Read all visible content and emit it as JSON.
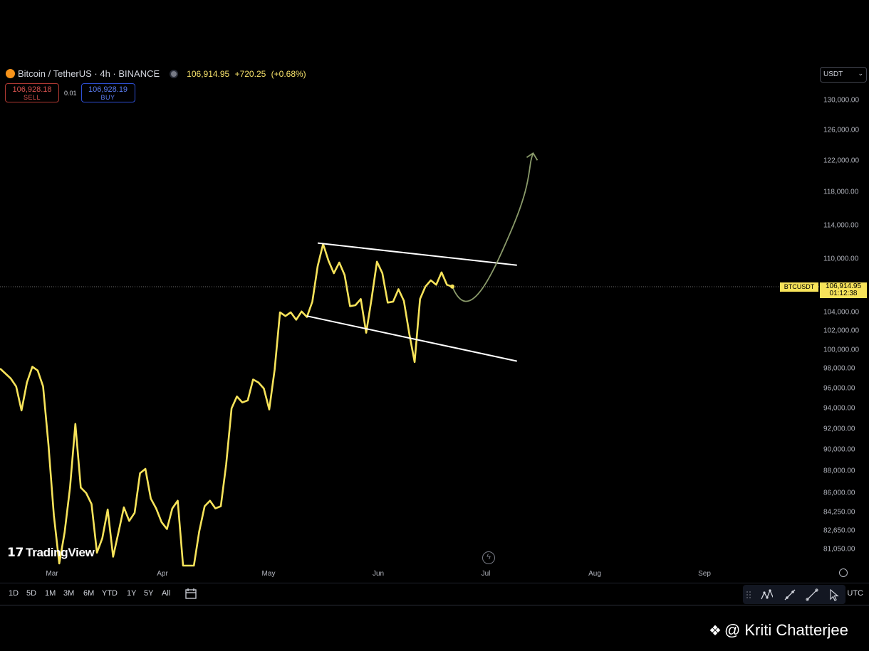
{
  "header": {
    "symbol_title": "Bitcoin / TetherUS · 4h · BINANCE",
    "last_price": "106,914.95",
    "change": "+720.25",
    "change_pct": "(+0.68%)",
    "sell_price": "106,928.18",
    "sell_label": "SELL",
    "spread": "0.01",
    "buy_price": "106,928.19",
    "buy_label": "BUY"
  },
  "currency_select": {
    "value": "USDT"
  },
  "price_axis": {
    "ticks": [
      "130,000.00",
      "126,000.00",
      "122,000.00",
      "118,000.00",
      "114,000.00",
      "110,000.00",
      "104,000.00",
      "102,000.00",
      "100,000.00",
      "98,000.00",
      "96,000.00",
      "94,000.00",
      "92,000.00",
      "90,000.00",
      "88,000.00",
      "86,000.00",
      "84,250.00",
      "82,650.00",
      "81,050.00"
    ],
    "current_symbol": "BTCUSDT",
    "current_price": "106,914.95",
    "countdown": "01:12:38"
  },
  "time_axis": {
    "labels": [
      "Mar",
      "Apr",
      "May",
      "Jun",
      "Jul",
      "Aug",
      "Sep"
    ]
  },
  "branding": {
    "logo_text": "TradingView",
    "watermark": "@ Kriti Chatterjee"
  },
  "bottom_bar": {
    "ranges": [
      "1D",
      "5D",
      "1M",
      "3M",
      "6M",
      "YTD",
      "1Y",
      "5Y",
      "All"
    ],
    "timezone": "UTC"
  },
  "colors": {
    "price_line": "#f7e35a",
    "channel": "#ffffff",
    "projection": "#8a9a6a",
    "background": "#000000"
  },
  "chart_data": {
    "type": "line",
    "series": [
      {
        "values": [
          [
            0,
            98000
          ],
          [
            1,
            97500
          ],
          [
            2,
            97000
          ],
          [
            3,
            96200
          ],
          [
            4,
            93800
          ],
          [
            5,
            96600
          ],
          [
            6,
            98200
          ],
          [
            7,
            97800
          ],
          [
            8,
            96200
          ],
          [
            9,
            90500
          ],
          [
            10,
            84000
          ],
          [
            11,
            80000
          ],
          [
            12,
            82500
          ],
          [
            13,
            86500
          ],
          [
            14,
            92500
          ],
          [
            15,
            86500
          ],
          [
            16,
            86000
          ],
          [
            17,
            85000
          ],
          [
            18,
            80800
          ],
          [
            19,
            82000
          ],
          [
            20,
            84500
          ],
          [
            21,
            80500
          ],
          [
            22,
            82500
          ],
          [
            23,
            84700
          ],
          [
            24,
            83500
          ],
          [
            25,
            84200
          ],
          [
            26,
            87800
          ],
          [
            27,
            88200
          ],
          [
            28,
            85500
          ],
          [
            29,
            84600
          ],
          [
            30,
            83400
          ],
          [
            31,
            82800
          ],
          [
            32,
            84600
          ],
          [
            33,
            85300
          ],
          [
            34,
            79000
          ],
          [
            35,
            78000
          ],
          [
            36,
            79300
          ],
          [
            37,
            82600
          ],
          [
            38,
            84800
          ],
          [
            39,
            85300
          ],
          [
            40,
            84600
          ],
          [
            41,
            84800
          ],
          [
            42,
            88600
          ],
          [
            43,
            94000
          ],
          [
            44,
            95200
          ],
          [
            45,
            94600
          ],
          [
            46,
            94800
          ],
          [
            47,
            96900
          ],
          [
            48,
            96600
          ],
          [
            49,
            96000
          ],
          [
            50,
            93900
          ],
          [
            51,
            97900
          ],
          [
            52,
            104000
          ],
          [
            53,
            103600
          ],
          [
            54,
            104000
          ],
          [
            55,
            103200
          ],
          [
            56,
            104100
          ],
          [
            57,
            103500
          ],
          [
            58,
            105200
          ],
          [
            59,
            109200
          ],
          [
            60,
            111800
          ],
          [
            61,
            109800
          ],
          [
            62,
            108400
          ],
          [
            63,
            109600
          ],
          [
            64,
            108200
          ],
          [
            65,
            104700
          ],
          [
            66,
            104800
          ],
          [
            67,
            105500
          ],
          [
            68,
            101800
          ],
          [
            69,
            105500
          ],
          [
            70,
            109700
          ],
          [
            71,
            108400
          ],
          [
            72,
            105100
          ],
          [
            73,
            105200
          ],
          [
            74,
            106600
          ],
          [
            75,
            105300
          ],
          [
            76,
            101700
          ],
          [
            77,
            98700
          ],
          [
            78,
            105500
          ],
          [
            79,
            106900
          ],
          [
            80,
            107600
          ],
          [
            81,
            107100
          ],
          [
            82,
            108500
          ],
          [
            83,
            107100
          ],
          [
            84,
            106900
          ]
        ]
      }
    ],
    "x_labels": [
      "Mar",
      "Apr",
      "May",
      "Jun",
      "Jul",
      "Aug",
      "Sep"
    ],
    "ylim": [
      80000,
      131000
    ],
    "annotations": {
      "channel_upper": [
        [
          59,
          111900
        ],
        [
          96,
          109300
        ]
      ],
      "channel_lower": [
        [
          57,
          103600
        ],
        [
          96,
          98800
        ]
      ],
      "projection": [
        [
          84,
          106900
        ],
        [
          87,
          104500
        ],
        [
          91,
          107600
        ],
        [
          95,
          113500
        ],
        [
          99,
          123000
        ]
      ]
    }
  }
}
